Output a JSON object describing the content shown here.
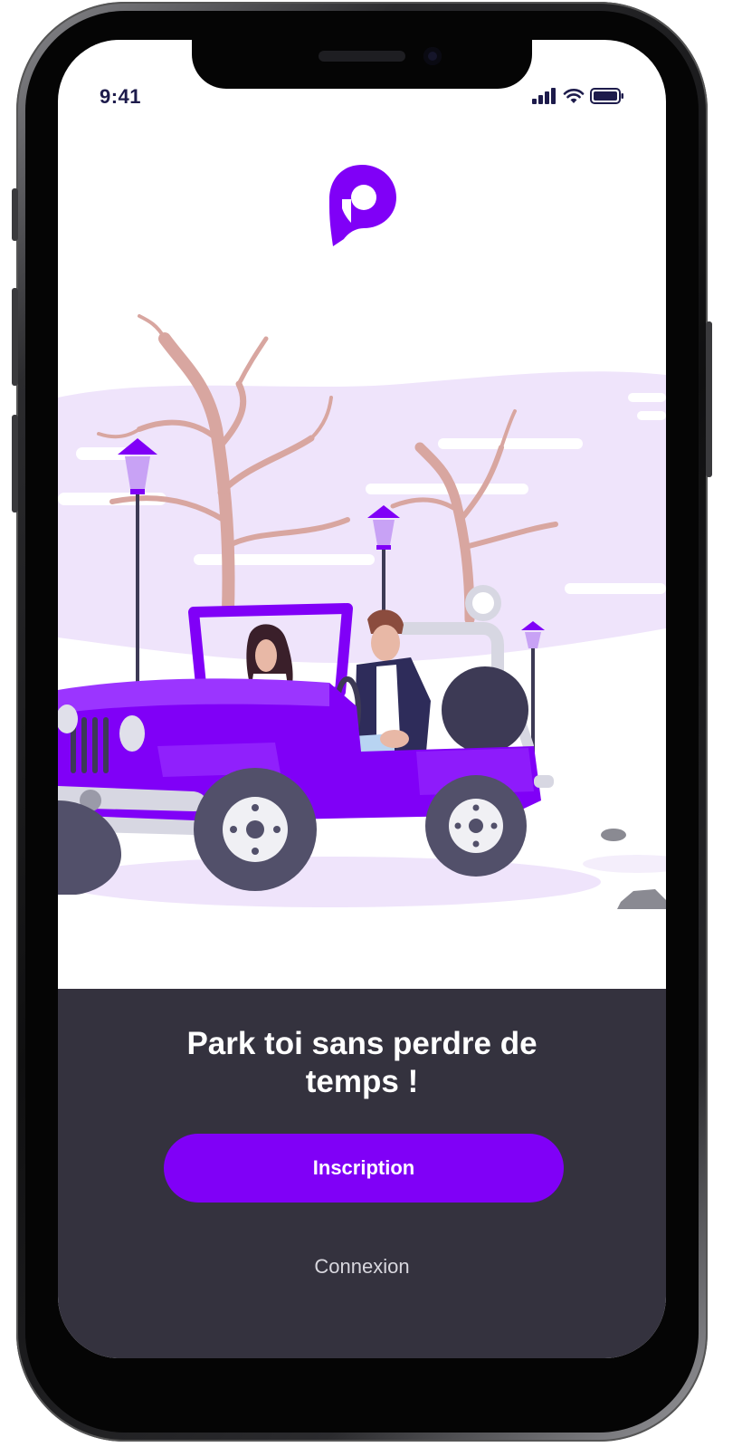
{
  "status_bar": {
    "time": "9:41",
    "icons": [
      "cellular-signal-icon",
      "wifi-icon",
      "battery-icon"
    ]
  },
  "brand": {
    "logo_icon": "parking-p-logo-icon",
    "accent_color": "#8000f7"
  },
  "illustration": {
    "description_icon": "jeep-couple-illustration"
  },
  "onboarding": {
    "headline_line1": "Park toi sans perdre de",
    "headline_line2": "temps !",
    "signup_label": "Inscription",
    "login_label": "Connexion"
  },
  "colors": {
    "panel_background": "#34323e",
    "button": "#8000f7",
    "text_light": "#ffffff",
    "link_text": "#d8d7de"
  }
}
